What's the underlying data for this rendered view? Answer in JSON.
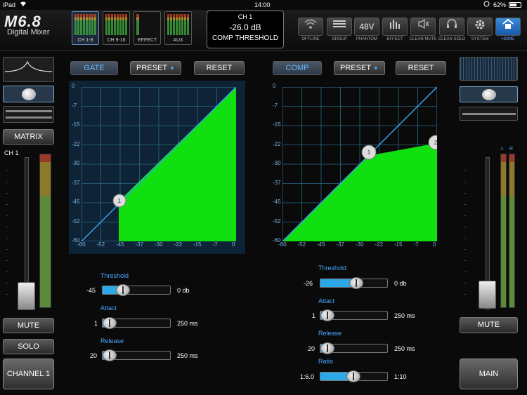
{
  "status": {
    "device": "iPad",
    "time": "14:00",
    "battery": "62%"
  },
  "brand": {
    "model": "M6.8",
    "subtitle": "Digital Mixer"
  },
  "channel_tabs": [
    "CH 1-8",
    "CH 9-16",
    "EFFECT",
    "AUX"
  ],
  "display": {
    "line1": "CH 1",
    "line2": "-26.0 dB",
    "line3": "COMP THRESHOLD"
  },
  "toolbar": [
    {
      "icon": "wifi-icon",
      "label": "OFFLINE"
    },
    {
      "icon": "group-icon",
      "label": "GROUP"
    },
    {
      "icon": "phantom-icon",
      "label": "PHANTOM",
      "glyph": "48V"
    },
    {
      "icon": "effect-icon",
      "label": "EFFECT"
    },
    {
      "icon": "clean-mute-icon",
      "label": "CLEAN MUTE"
    },
    {
      "icon": "clean-solo-icon",
      "label": "CLEAN SOLO"
    },
    {
      "icon": "gear-icon",
      "label": "SYSTEM"
    },
    {
      "icon": "home-icon",
      "label": "HOME"
    }
  ],
  "left_panel": {
    "matrix": "MATRIX",
    "channel_label": "CH 1",
    "mute": "MUTE",
    "solo": "SOLO",
    "channel_button": "CHANNEL 1"
  },
  "right_panel": {
    "meter_left": "L",
    "meter_right": "R",
    "mute": "MUTE",
    "main": "MAIN"
  },
  "gate": {
    "title": "GATE",
    "preset": "PRESET",
    "reset": "RESET",
    "y_ticks": [
      "0",
      "-7",
      "-15",
      "-22",
      "-30",
      "-37",
      "-45",
      "-52",
      "-60"
    ],
    "x_ticks": [
      "-60",
      "-52",
      "-45",
      "-37",
      "-30",
      "-22",
      "-15",
      "-7",
      "0"
    ],
    "point_label": "1",
    "threshold": {
      "label": "Threshold",
      "value": "-45",
      "max": "0 db",
      "position": 0.25
    },
    "attack": {
      "label": "Attact",
      "value": "1",
      "max": "250 ms",
      "position": 0.0
    },
    "release": {
      "label": "Release",
      "value": "20",
      "max": "250 ms",
      "position": 0.0
    }
  },
  "comp": {
    "title": "COMP",
    "preset": "PRESET",
    "reset": "RESET",
    "y_ticks": [
      "0",
      "-7",
      "-15",
      "-22",
      "-30",
      "-37",
      "-45",
      "-52",
      "-60"
    ],
    "x_ticks": [
      "-60",
      "-52",
      "-45",
      "-37",
      "-30",
      "-22",
      "-15",
      "-7",
      "0"
    ],
    "point1_label": "1",
    "point2_label": "2",
    "threshold": {
      "label": "Threshold",
      "value": "-26",
      "max": "0 db",
      "position": 0.56
    },
    "attack": {
      "label": "Attact",
      "value": "1",
      "max": "250 ms",
      "position": 0.0
    },
    "release": {
      "label": "Release",
      "value": "20",
      "max": "250 ms",
      "position": 0.0
    },
    "ratio": {
      "label": "Ratio",
      "value": "1:6.0",
      "max": "1:10",
      "position": 0.5
    }
  },
  "colors": {
    "accent": "#2aa8e8",
    "curve_fill": "#10e010",
    "graph_bg": "#0e2436",
    "home": "#2a7ad8"
  }
}
